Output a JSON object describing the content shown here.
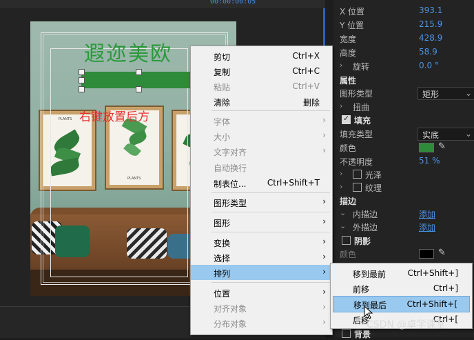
{
  "toolbar": {
    "timecode": "00:00:00:05"
  },
  "canvas": {
    "title_text": "遐迩美欧",
    "red_text": "右键放置后方",
    "poster_frame_label": "PLANTS",
    "colors": {
      "title": "#2a9a3a",
      "bar": "#2e8b3a",
      "red_text": "#e83030"
    }
  },
  "panel": {
    "x_label": "X 位置",
    "x_value": "393.1",
    "y_label": "Y 位置",
    "y_value": "215.9",
    "width_label": "宽度",
    "width_value": "428.9",
    "height_label": "高度",
    "height_value": "58.9",
    "rotation_label": "旋转",
    "rotation_value": "0.0 °",
    "properties_header": "属性",
    "shape_type_label": "图形类型",
    "shape_type_value": "矩形",
    "twist_label": "扭曲",
    "fill_header": "填充",
    "fill_type_label": "填充类型",
    "fill_type_value": "实底",
    "color_label": "颜色",
    "fill_color": "#2e8b3a",
    "opacity_label": "不透明度",
    "opacity_value": "51 %",
    "gloss_label": "光泽",
    "texture_label": "纹理",
    "stroke_header": "描边",
    "inner_stroke_label": "内描边",
    "inner_stroke_link": "添加",
    "outer_stroke_label": "外描边",
    "outer_stroke_link": "添加",
    "shadow_header": "阴影",
    "shadow_color_label": "颜色",
    "shadow_color": "#000000",
    "background_header": "背景"
  },
  "context_menu": {
    "items": [
      {
        "label": "剪切",
        "shortcut": "Ctrl+X",
        "disabled": false
      },
      {
        "label": "复制",
        "shortcut": "Ctrl+C",
        "disabled": false
      },
      {
        "label": "粘贴",
        "shortcut": "Ctrl+V",
        "disabled": true
      },
      {
        "label": "清除",
        "shortcut": "删除",
        "disabled": false
      },
      {
        "label": "字体",
        "disabled": true
      },
      {
        "label": "大小",
        "disabled": true
      },
      {
        "label": "文字对齐",
        "disabled": true
      },
      {
        "label": "自动换行",
        "disabled": true
      },
      {
        "label": "制表位...",
        "shortcut": "Ctrl+Shift+T",
        "disabled": false
      },
      {
        "label": "图形类型",
        "disabled": false
      },
      {
        "label": "图形",
        "disabled": false
      },
      {
        "label": "变换",
        "disabled": false
      },
      {
        "label": "选择",
        "disabled": false
      },
      {
        "label": "排列",
        "disabled": false,
        "highlighted": true
      },
      {
        "label": "位置",
        "disabled": false
      },
      {
        "label": "对齐对象",
        "disabled": true
      },
      {
        "label": "分布对象",
        "disabled": true
      }
    ]
  },
  "arrange_submenu": {
    "items": [
      {
        "label": "移到最前",
        "shortcut": "Ctrl+Shift+]"
      },
      {
        "label": "前移",
        "shortcut": "Ctrl+]"
      },
      {
        "label": "移到最后",
        "shortcut": "Ctrl+Shift+[",
        "highlighted": true
      },
      {
        "label": "后移",
        "shortcut": "Ctrl+["
      }
    ]
  },
  "watermark": "CSDN @卓学课堂"
}
